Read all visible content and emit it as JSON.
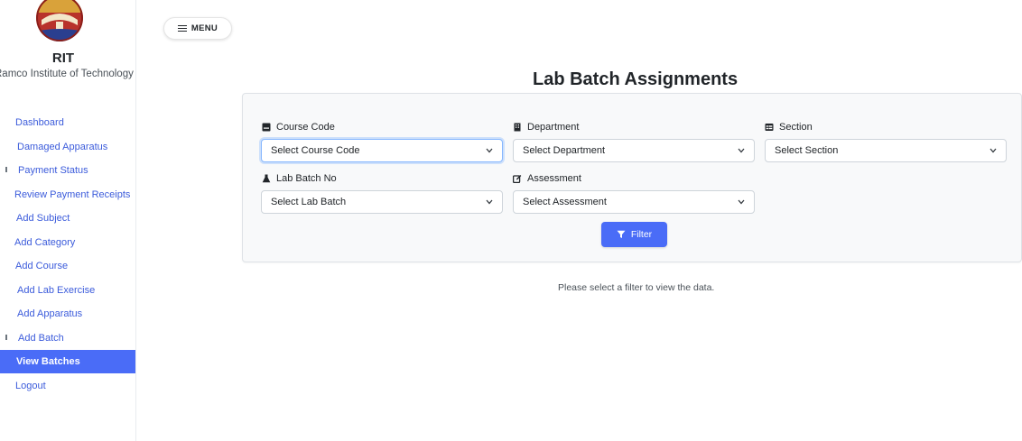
{
  "sidebar": {
    "brand_short": "RIT",
    "brand_full": "Ramco Institute of Technology",
    "items": [
      {
        "label": "Dashboard"
      },
      {
        "label": "Damaged Apparatus"
      },
      {
        "label": "Payment Status"
      },
      {
        "label": "Review Payment Receipts"
      },
      {
        "label": "Add Subject"
      },
      {
        "label": "Add Category"
      },
      {
        "label": "Add Course"
      },
      {
        "label": "Add Lab Exercise"
      },
      {
        "label": "Add Apparatus"
      },
      {
        "label": "Add Batch"
      },
      {
        "label": "View Batches",
        "active": true
      },
      {
        "label": "Logout"
      }
    ]
  },
  "header": {
    "menu_label": "MENU"
  },
  "main": {
    "title": "Lab Batch Assignments",
    "filters": {
      "course_code": {
        "label": "Course Code",
        "value": "Select Course Code",
        "icon": "book-icon"
      },
      "department": {
        "label": "Department",
        "value": "Select Department",
        "icon": "building-icon"
      },
      "section": {
        "label": "Section",
        "value": "Select Section",
        "icon": "table-icon"
      },
      "lab_batch": {
        "label": "Lab Batch No",
        "value": "Select Lab Batch",
        "icon": "flask-icon"
      },
      "assessment": {
        "label": "Assessment",
        "value": "Select Assessment",
        "icon": "edit-icon"
      }
    },
    "filter_button": "Filter",
    "empty_message": "Please select a filter to view the data."
  },
  "colors": {
    "accent": "#4a6cf7",
    "link": "#3b5bdb",
    "card_bg": "#f8f9fa"
  }
}
